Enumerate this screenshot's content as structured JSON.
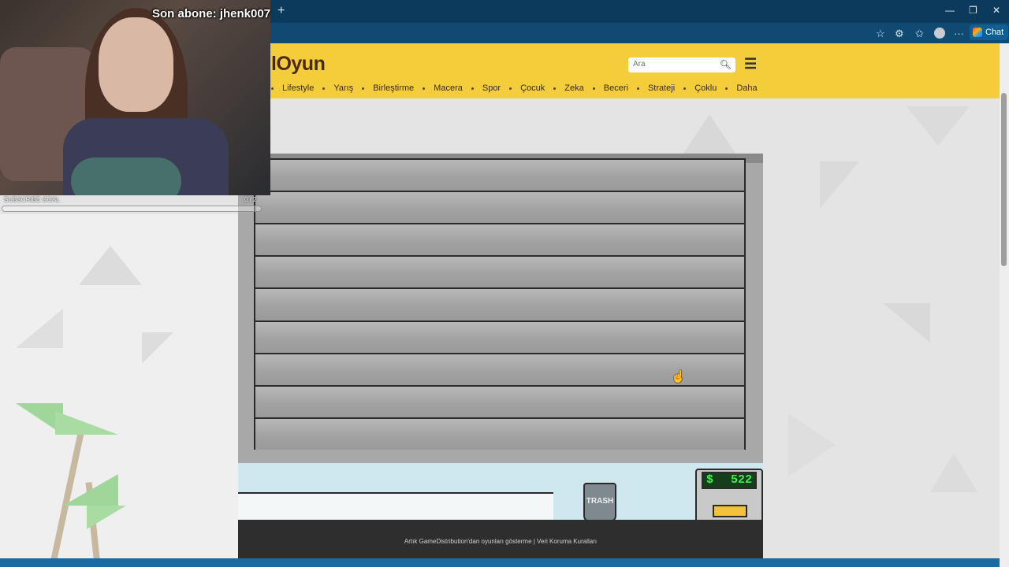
{
  "browser": {
    "new_tab_symbol": "+",
    "window_controls": {
      "minimize": "—",
      "restore": "❐",
      "close": "✕"
    },
    "toolbar_icons": [
      "favorite-star-icon",
      "extensions-icon",
      "favorites-icon",
      "profile-icon",
      "more-icon"
    ],
    "more_symbol": "···",
    "chat_label": "Chat"
  },
  "site": {
    "logo": "lOyun",
    "search": {
      "placeholder": "Ara"
    },
    "nav": [
      "Lifestyle",
      "Yarış",
      "Birleştirme",
      "Macera",
      "Spor",
      "Çocuk",
      "Zeka",
      "Beceri",
      "Strateji",
      "Çoklu",
      "Daha"
    ]
  },
  "game": {
    "money_symbol": "$",
    "money": "522",
    "trash_label": "TRASH"
  },
  "footer": {
    "text": "Artık GameDistribution'dan oyunları gösterme | Veri Koruma Kuralları"
  },
  "stream": {
    "sub_label": "Son abone: jhenk007",
    "goal_label": "SUBSCRIBE GOAL",
    "goal_current": 0,
    "goal_target": 2,
    "goal_count_text": "0 / 2"
  },
  "colors": {
    "header": "#f4cd3b",
    "browser_bar": "#0b3a5c",
    "money_text": "#3cf04a"
  }
}
